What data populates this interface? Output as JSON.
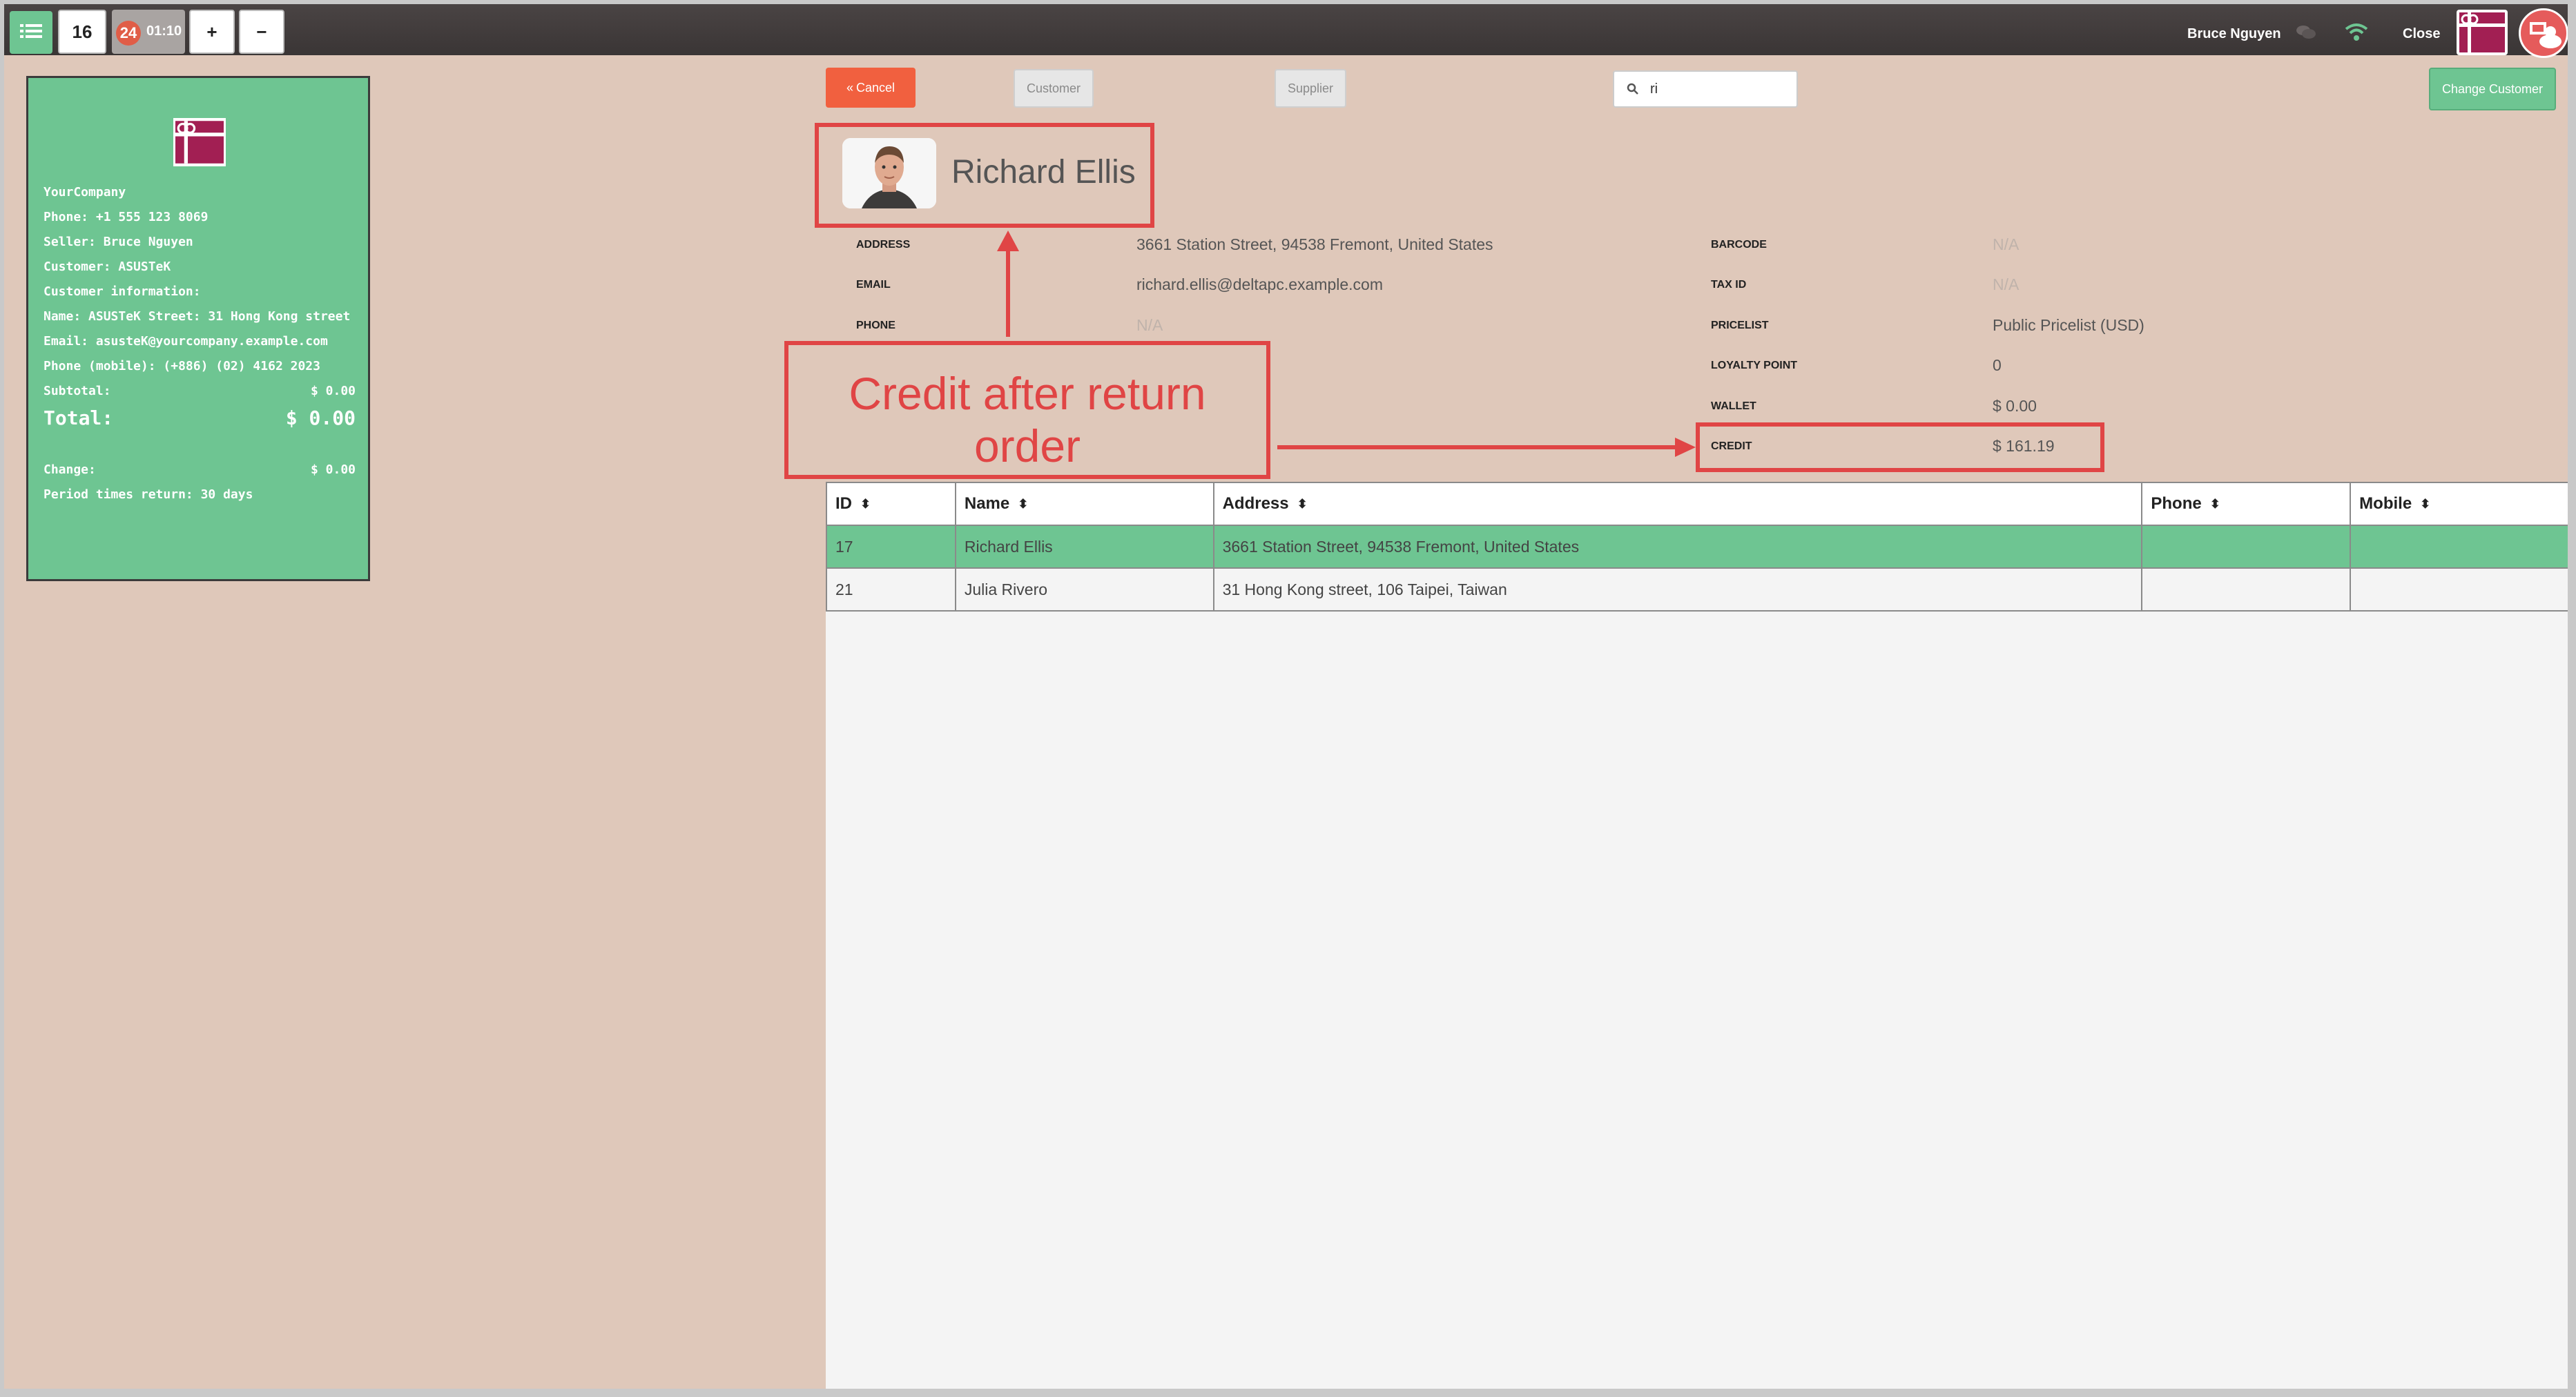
{
  "topbar": {
    "order_number": "16",
    "order_badge": "24",
    "order_time": "01:10",
    "add_label": "+",
    "remove_label": "−",
    "user_name": "Bruce Nguyen",
    "close_label": "Close"
  },
  "receipt": {
    "company": "YourCompany",
    "phone": "Phone: +1 555 123 8069",
    "seller": "Seller: Bruce Nguyen",
    "customer": "Customer: ASUSTeK",
    "customer_info": "Customer information:",
    "name_street": "Name: ASUSTeK Street: 31 Hong Kong street",
    "email": "Email: asusteK@yourcompany.example.com",
    "phone_mobile": "Phone (mobile): (+886) (02) 4162 2023",
    "subtotal_label": "Subtotal:",
    "subtotal_value": "$ 0.00",
    "total_label": "Total:",
    "total_value": "$ 0.00",
    "change_label": "Change:",
    "change_value": "$ 0.00",
    "period": "Period times return: 30 days"
  },
  "toolbar": {
    "cancel_label": "Cancel",
    "customer_label": "Customer",
    "supplier_label": "Supplier",
    "search_value": "ri",
    "change_customer_label": "Change Customer"
  },
  "customer": {
    "name": "Richard Ellis",
    "details_left": [
      {
        "label": "ADDRESS",
        "value": "3661 Station Street, 94538 Fremont, United States"
      },
      {
        "label": "EMAIL",
        "value": "richard.ellis@deltapc.example.com"
      },
      {
        "label": "PHONE",
        "value": "N/A"
      }
    ],
    "details_right": [
      {
        "label": "BARCODE",
        "value": "N/A"
      },
      {
        "label": "TAX ID",
        "value": "N/A"
      },
      {
        "label": "PRICELIST",
        "value": "Public Pricelist (USD)"
      },
      {
        "label": "LOYALTY POINT",
        "value": "0"
      },
      {
        "label": "WALLET",
        "value": "$ 0.00"
      },
      {
        "label": "CREDIT",
        "value": "$ 161.19"
      }
    ]
  },
  "table": {
    "headers": [
      "ID",
      "Name",
      "Address",
      "Phone",
      "Mobile"
    ],
    "rows": [
      {
        "id": "17",
        "name": "Richard Ellis",
        "address": "3661 Station Street, 94538 Fremont, United States",
        "phone": "",
        "mobile": ""
      },
      {
        "id": "21",
        "name": "Julia Rivero",
        "address": "31 Hong Kong street, 106 Taipei, Taiwan",
        "phone": "",
        "mobile": ""
      }
    ]
  },
  "annotation": {
    "line1": "Credit after return",
    "line2": "order"
  },
  "colors": {
    "accent_green": "#6ec592",
    "cancel_orange": "#f1603f",
    "annotation_red": "#e04545",
    "background": "#dfc8ba"
  }
}
